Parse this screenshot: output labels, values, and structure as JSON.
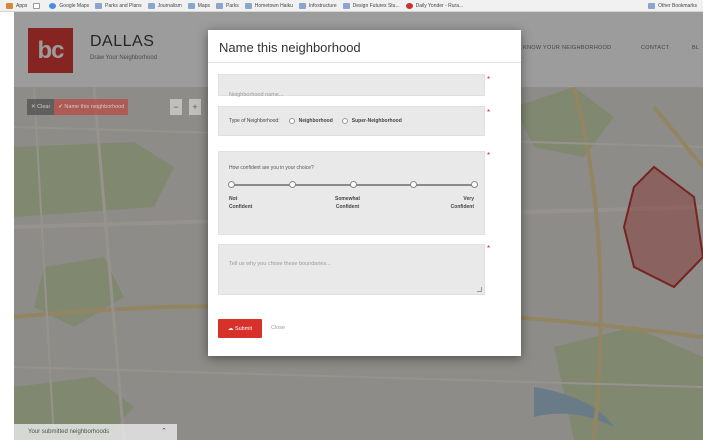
{
  "bookmarks": [
    {
      "label": "Apps",
      "icon": "apps-icon"
    },
    {
      "label": "",
      "icon": "page-icon"
    },
    {
      "label": "Google Maps",
      "icon": "google-icon"
    },
    {
      "label": "Parks and Plans",
      "icon": "folder-icon"
    },
    {
      "label": "Journalism",
      "icon": "folder-icon"
    },
    {
      "label": "Maps",
      "icon": "folder-icon"
    },
    {
      "label": "Parks",
      "icon": "folder-icon"
    },
    {
      "label": "Hometown Haiku",
      "icon": "folder-icon"
    },
    {
      "label": "Infostructure",
      "icon": "folder-icon"
    },
    {
      "label": "Design Futures Stu...",
      "icon": "folder-icon"
    },
    {
      "label": "Daily Yonder - Rura...",
      "icon": "yonder-icon"
    }
  ],
  "bookmarks_other": "Other Bookmarks",
  "header": {
    "logo": "bc",
    "title": "DALLAS",
    "subtitle": "Draw Your Neighborhood",
    "nav": [
      "KNOW YOUR NEIGHBORHOOD",
      "CONTACT",
      "BL"
    ]
  },
  "map_toolbar": {
    "clear_label": "✕ Clear",
    "name_label": "✔ Name this neighborhood",
    "zoom_out": "−",
    "zoom_in": "+"
  },
  "saved_panel": {
    "label": "Your submitted neighborhoods",
    "chevron": "⌃"
  },
  "modal": {
    "title": "Name this neighborhood",
    "name_placeholder": "Neighborhood name...",
    "type_label": "Type of Neighborhood:",
    "type_options": [
      "Neighborhood",
      "Super-Neighborhood"
    ],
    "confidence_label": "How confident are you in your choice?",
    "confidence_ticks": [
      {
        "line1": "Not",
        "line2": "Confident"
      },
      {
        "line1": "Somewhat",
        "line2": "Confident"
      },
      {
        "line1": "Very",
        "line2": "Confident"
      }
    ],
    "slider_stops": 5,
    "reason_placeholder": "Tell us why you chose these boundaries...",
    "submit_label": "☁ Submit",
    "close_label": "Close",
    "required_mark": "*"
  },
  "colors": {
    "brand": "#d8312a",
    "required": "#d3262a"
  }
}
